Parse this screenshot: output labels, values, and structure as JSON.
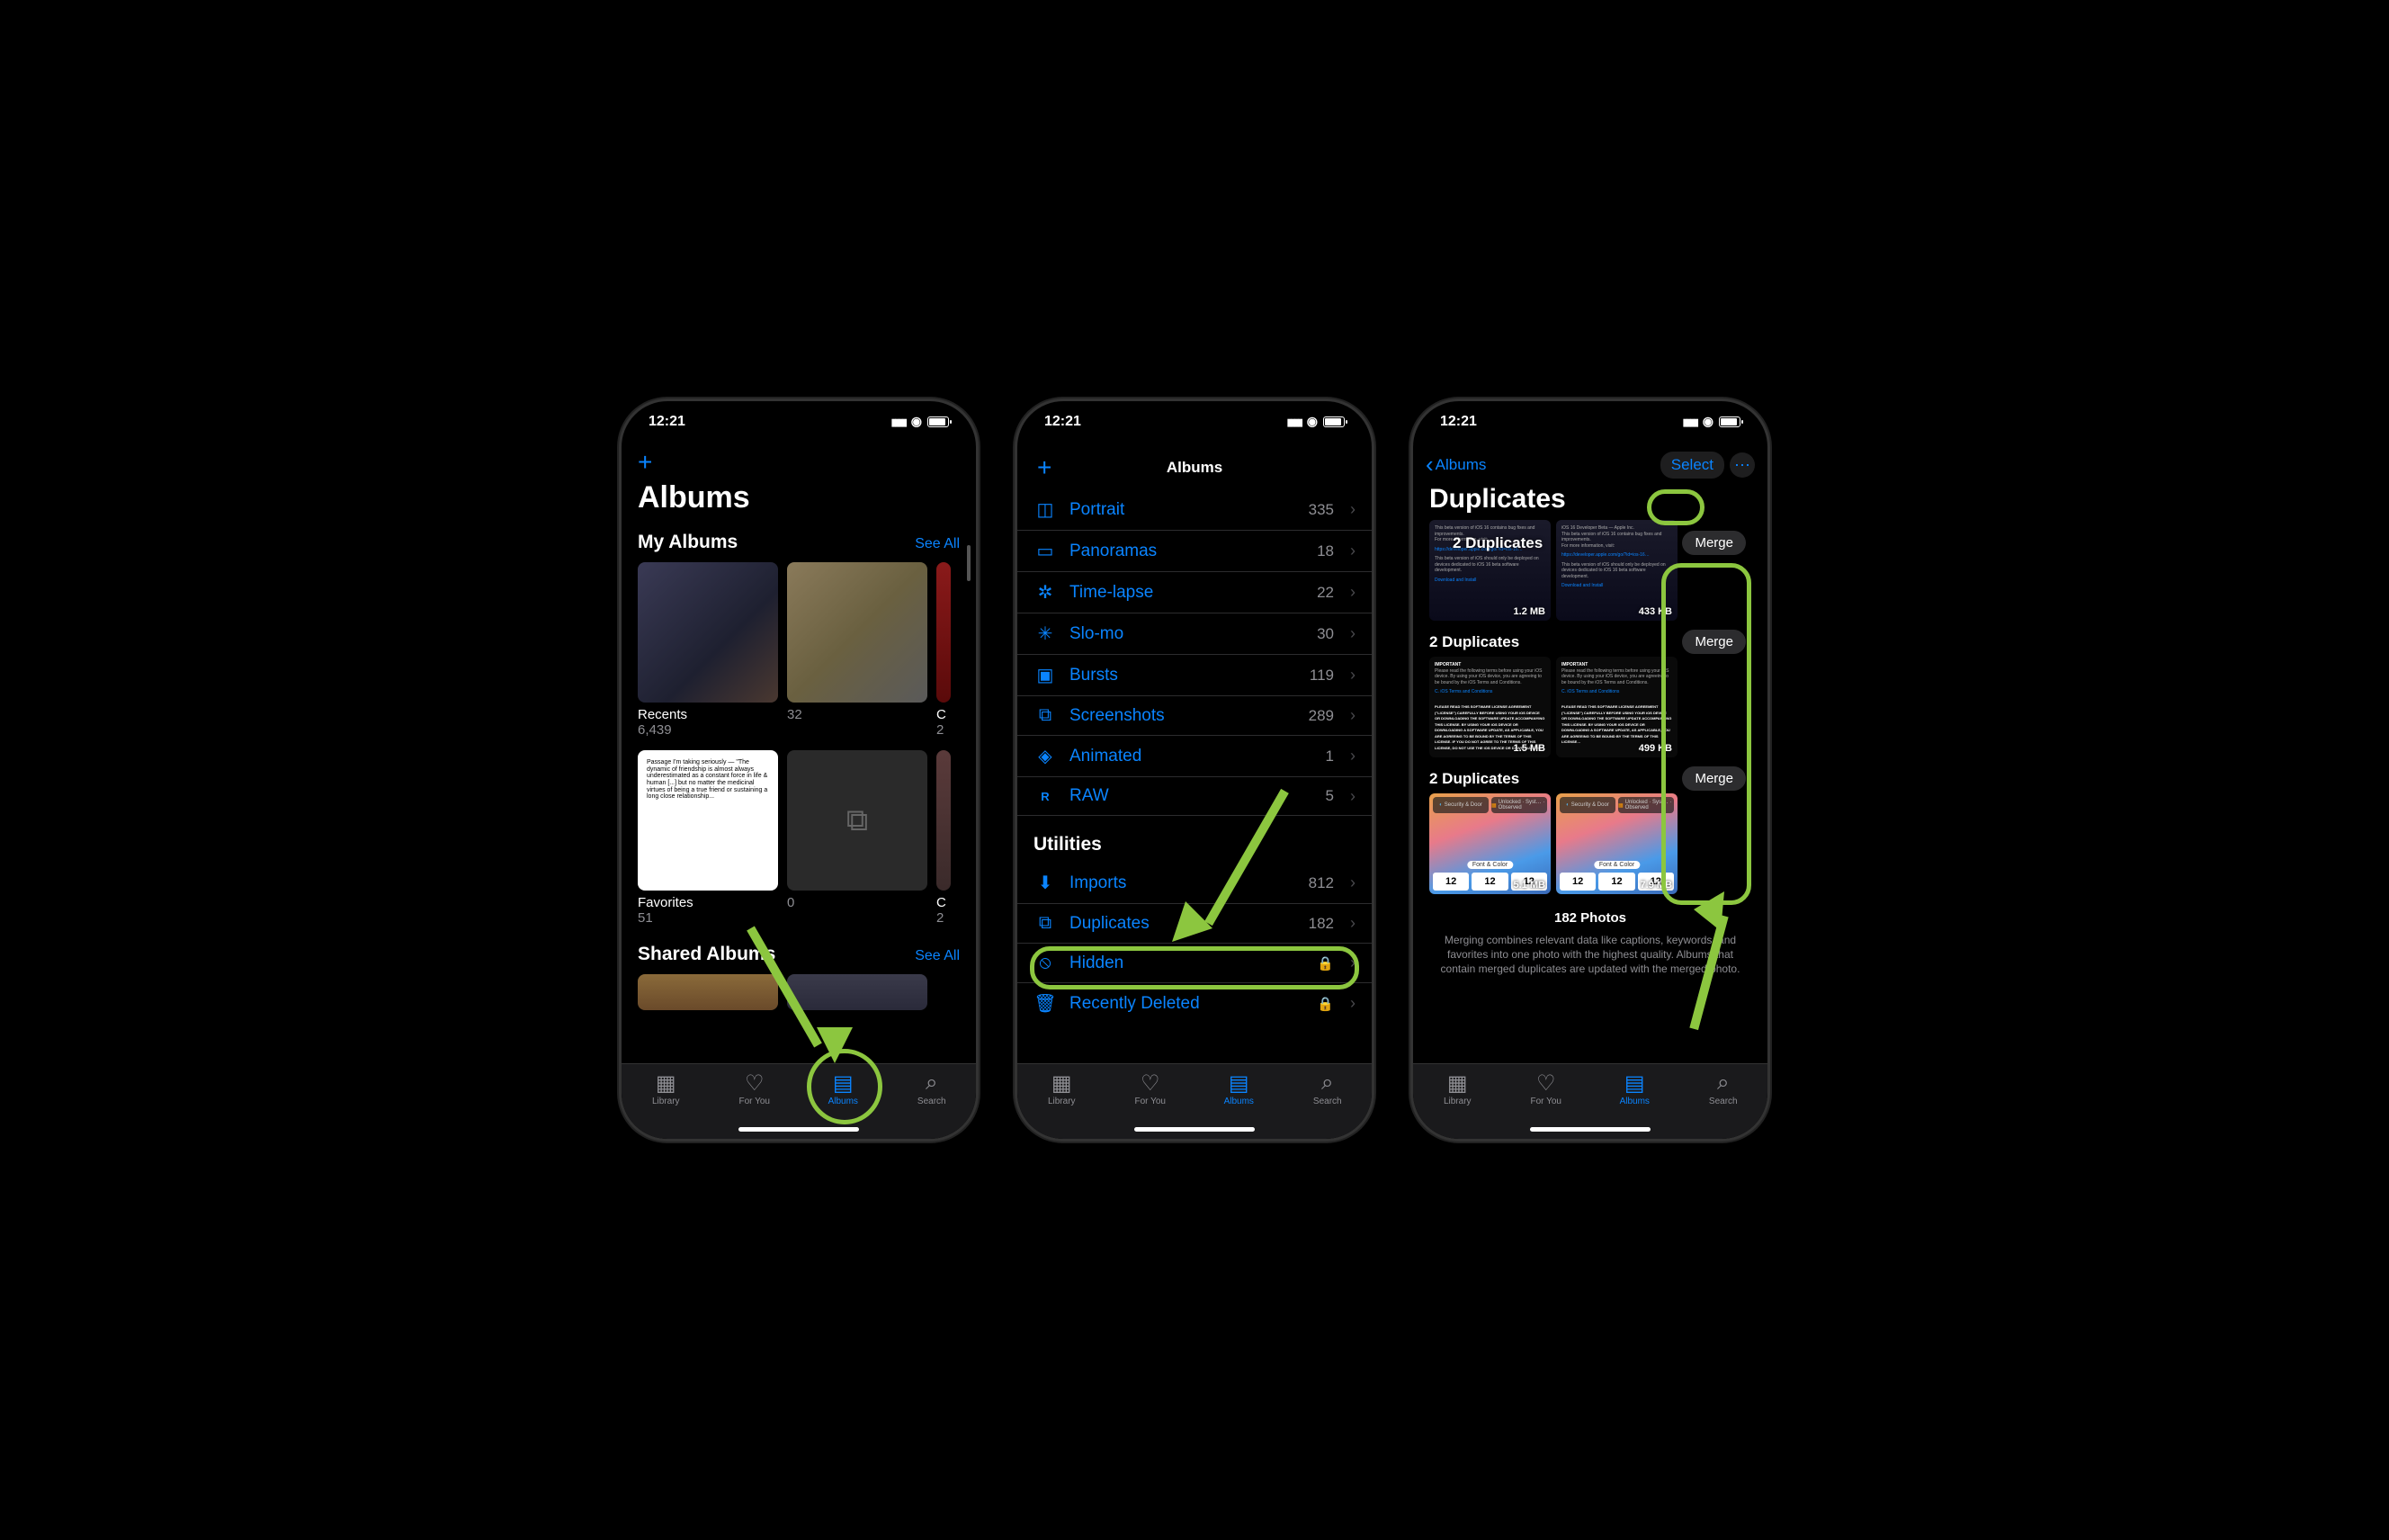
{
  "status": {
    "time": "12:21"
  },
  "colors": {
    "accent": "#0a84ff",
    "highlight": "#8cc63f"
  },
  "tabs": {
    "library": "Library",
    "for_you": "For You",
    "albums": "Albums",
    "search": "Search"
  },
  "phone1": {
    "title": "Albums",
    "sections": {
      "my_albums": {
        "label": "My Albums",
        "see_all": "See All"
      },
      "shared_albums": {
        "label": "Shared Albums",
        "see_all": "See All"
      }
    },
    "cards": {
      "recents": {
        "name": "Recents",
        "count": "6,439"
      },
      "second": {
        "name": "",
        "count": "32"
      },
      "third_cut": {
        "name": "C",
        "count": "2"
      },
      "favorites": {
        "name": "Favorites",
        "count": "51"
      },
      "empty": {
        "name": "",
        "count": "0"
      },
      "cut2": {
        "name": "C",
        "count": "2"
      }
    }
  },
  "phone2": {
    "title": "Albums",
    "media_types": [
      {
        "icon": "◯",
        "name": "Portrait",
        "count": "335"
      },
      {
        "icon": "▭",
        "name": "Panoramas",
        "count": "18"
      },
      {
        "icon": "✲",
        "name": "Time-lapse",
        "count": "22"
      },
      {
        "icon": "✳",
        "name": "Slo-mo",
        "count": "30"
      },
      {
        "icon": "▣",
        "name": "Bursts",
        "count": "119"
      },
      {
        "icon": "⧉",
        "name": "Screenshots",
        "count": "289"
      },
      {
        "icon": "◈",
        "name": "Animated",
        "count": "1"
      },
      {
        "icon": "R",
        "name": "RAW",
        "count": "5"
      }
    ],
    "utilities_label": "Utilities",
    "utilities": [
      {
        "icon": "⬇",
        "name": "Imports",
        "count": "812",
        "lock": false
      },
      {
        "icon": "⧉",
        "name": "Duplicates",
        "count": "182",
        "lock": false
      },
      {
        "icon": "⦸",
        "name": "Hidden",
        "count": "",
        "lock": true
      },
      {
        "icon": "🗑",
        "name": "Recently Deleted",
        "count": "",
        "lock": true
      }
    ]
  },
  "phone3": {
    "back": "Albums",
    "select": "Select",
    "title": "Duplicates",
    "groups": [
      {
        "title": "2 Duplicates",
        "merge": "Merge",
        "sizes": [
          "1.2 MB",
          "433 KB"
        ]
      },
      {
        "title": "2 Duplicates",
        "merge": "Merge",
        "sizes": [
          "1.5 MB",
          "499 KB"
        ]
      },
      {
        "title": "2 Duplicates",
        "merge": "Merge",
        "sizes": [
          "5.1 MB",
          "7.9 MB"
        ],
        "numbers": "12"
      }
    ],
    "footer_count": "182 Photos",
    "footer_text": "Merging combines relevant data like captions, keywords, and favorites into one photo with the highest quality. Albums that contain merged duplicates are updated with the merged photo.",
    "widget_fc": "Font & Color"
  }
}
